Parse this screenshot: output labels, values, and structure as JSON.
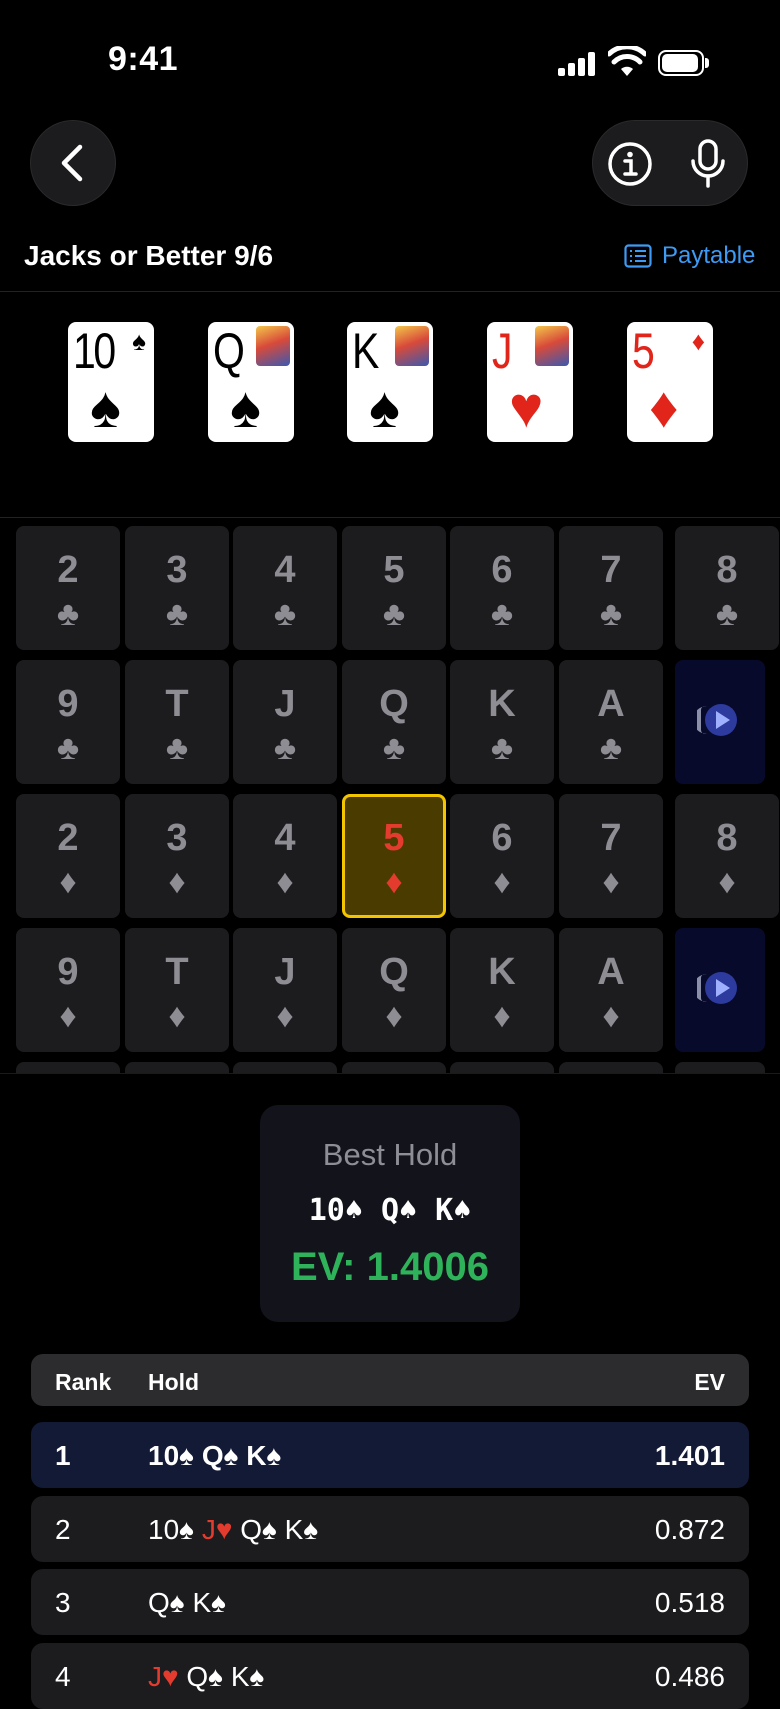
{
  "status_bar": {
    "time": "9:41"
  },
  "header": {
    "title": "Jacks or Better 9/6",
    "paytable_label": "Paytable"
  },
  "hand": [
    {
      "rank": "10",
      "suit": "♠",
      "color": "black"
    },
    {
      "rank": "Q",
      "suit": "♠",
      "color": "black"
    },
    {
      "rank": "K",
      "suit": "♠",
      "color": "black"
    },
    {
      "rank": "J",
      "suit": "♥",
      "color": "red"
    },
    {
      "rank": "5",
      "suit": "♦",
      "color": "red"
    }
  ],
  "grid": {
    "rows": [
      {
        "suit": "♣",
        "ranks": [
          "2",
          "3",
          "4",
          "5",
          "6",
          "7",
          "8"
        ],
        "play_button": false
      },
      {
        "suit": "♣",
        "ranks": [
          "9",
          "T",
          "J",
          "Q",
          "K",
          "A"
        ],
        "play_button": true
      },
      {
        "suit": "♦",
        "ranks": [
          "2",
          "3",
          "4",
          "5",
          "6",
          "7",
          "8"
        ],
        "play_button": false,
        "selected_index": 3
      },
      {
        "suit": "♦",
        "ranks": [
          "9",
          "T",
          "J",
          "Q",
          "K",
          "A"
        ],
        "play_button": true
      }
    ]
  },
  "best_hold": {
    "label": "Best Hold",
    "cards": "10♠ Q♠ K♠",
    "ev": "EV: 1.4006"
  },
  "results_table": {
    "columns": [
      "Rank",
      "Hold",
      "EV"
    ],
    "rows": [
      {
        "rank": "1",
        "hold": [
          {
            "t": "10♠",
            "red": false
          },
          {
            "t": "Q♠",
            "red": false
          },
          {
            "t": "K♠",
            "red": false
          }
        ],
        "ev": "1.401"
      },
      {
        "rank": "2",
        "hold": [
          {
            "t": "10♠",
            "red": false
          },
          {
            "t": "J♥",
            "red": true
          },
          {
            "t": "Q♠",
            "red": false
          },
          {
            "t": "K♠",
            "red": false
          }
        ],
        "ev": "0.872"
      },
      {
        "rank": "3",
        "hold": [
          {
            "t": "Q♠",
            "red": false
          },
          {
            "t": "K♠",
            "red": false
          }
        ],
        "ev": "0.518"
      },
      {
        "rank": "4",
        "hold": [
          {
            "t": "J♥",
            "red": true
          },
          {
            "t": "Q♠",
            "red": false
          },
          {
            "t": "K♠",
            "red": false
          }
        ],
        "ev": "0.486"
      }
    ]
  },
  "colors": {
    "accent_blue": "#3e9bf5",
    "ev_green": "#2fb35a",
    "selected_border": "#f2c500",
    "red_suit": "#e33b2e"
  },
  "icons": [
    "back-chevron-icon",
    "info-icon",
    "microphone-icon",
    "paytable-list-icon",
    "play-icon"
  ]
}
